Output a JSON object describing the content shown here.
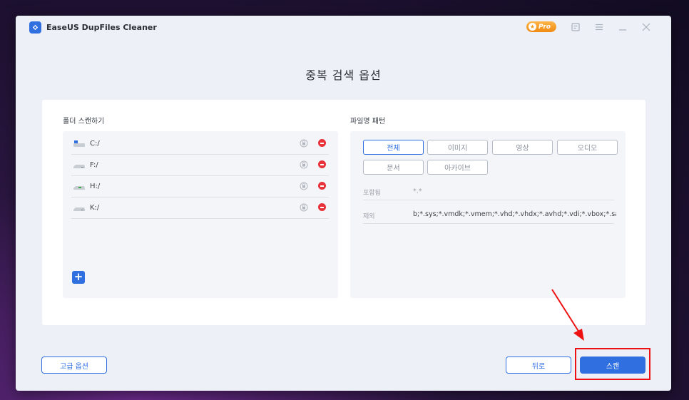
{
  "app": {
    "title": "EaseUS DupFiles Cleaner",
    "pro_label": "Pro"
  },
  "page": {
    "heading": "중복 검색 옵션"
  },
  "folders": {
    "label": "폴더 스캔하기",
    "drives": [
      {
        "name": "C:/"
      },
      {
        "name": "F:/"
      },
      {
        "name": "H:/"
      },
      {
        "name": "K:/"
      }
    ],
    "add_label": "+"
  },
  "patterns": {
    "label": "파일명 패턴",
    "filters": [
      "전체",
      "이미지",
      "영상",
      "오디오",
      "문서",
      "아카이브"
    ],
    "active_filter": "전체",
    "include_label": "포함됨",
    "include_value": "*.*",
    "exclude_label": "제외",
    "exclude_value": "b;*.sys;*.vmdk;*.vmem;*.vhd;*.vhdx;*.avhd;*.vdi;*.vbox;*.sav;"
  },
  "footer": {
    "advanced_label": "고급 옵션",
    "back_label": "뒤로",
    "scan_label": "스캔"
  },
  "colors": {
    "accent": "#2f6fe0",
    "remove": "#e8323a",
    "highlight": "#ee1111",
    "pro": "#f08a12"
  }
}
